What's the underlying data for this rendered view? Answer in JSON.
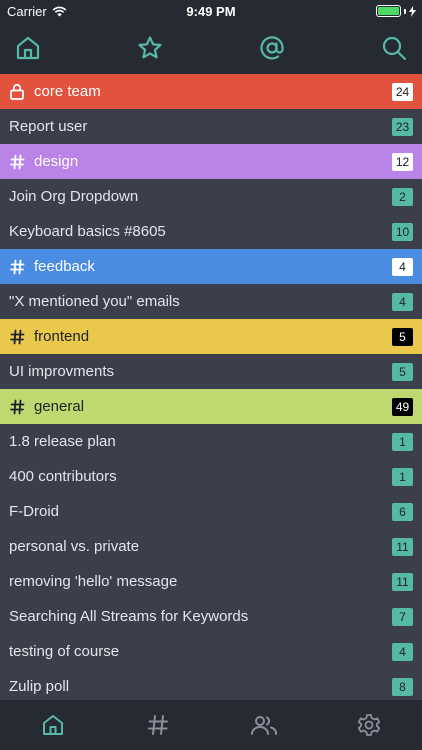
{
  "status_bar": {
    "carrier": "Carrier",
    "time": "9:49 PM"
  },
  "top_nav": {
    "icons": [
      "home-icon",
      "star-icon",
      "at-sign-icon",
      "search-icon"
    ]
  },
  "colors": {
    "accent": "#56b9a5",
    "core_team": "#e3523d",
    "design": "#b983e8",
    "feedback": "#4a8ce2",
    "frontend": "#e9c84b",
    "general": "#bfd870"
  },
  "rows": [
    {
      "kind": "stream",
      "name": "core team",
      "icon": "lock-icon",
      "count": "24"
    },
    {
      "kind": "topic",
      "name": "Report user",
      "count": "23"
    },
    {
      "kind": "stream",
      "name": "design",
      "icon": "hash-icon",
      "count": "12"
    },
    {
      "kind": "topic",
      "name": "Join Org Dropdown",
      "count": "2"
    },
    {
      "kind": "topic",
      "name": "Keyboard basics #8605",
      "count": "10"
    },
    {
      "kind": "stream",
      "name": "feedback",
      "icon": "hash-icon",
      "count": "4"
    },
    {
      "kind": "topic",
      "name": "\"X mentioned you\" emails",
      "count": "4"
    },
    {
      "kind": "stream",
      "name": "frontend",
      "icon": "hash-icon",
      "count": "5"
    },
    {
      "kind": "topic",
      "name": "UI improvments",
      "count": "5"
    },
    {
      "kind": "stream",
      "name": "general",
      "icon": "hash-icon",
      "count": "49"
    },
    {
      "kind": "topic",
      "name": "1.8 release plan",
      "count": "1"
    },
    {
      "kind": "topic",
      "name": "400 contributors",
      "count": "1"
    },
    {
      "kind": "topic",
      "name": "F-Droid",
      "count": "6"
    },
    {
      "kind": "topic",
      "name": "personal vs. private",
      "count": "11"
    },
    {
      "kind": "topic",
      "name": "removing 'hello' message",
      "count": "11"
    },
    {
      "kind": "topic",
      "name": "Searching All Streams for Keywords",
      "count": "7"
    },
    {
      "kind": "topic",
      "name": "testing of course",
      "count": "4"
    },
    {
      "kind": "topic",
      "name": "Zulip poll",
      "count": "8"
    }
  ],
  "tab_bar": {
    "icons": [
      "home-tab-icon",
      "streams-tab-icon",
      "people-tab-icon",
      "settings-tab-icon"
    ]
  }
}
